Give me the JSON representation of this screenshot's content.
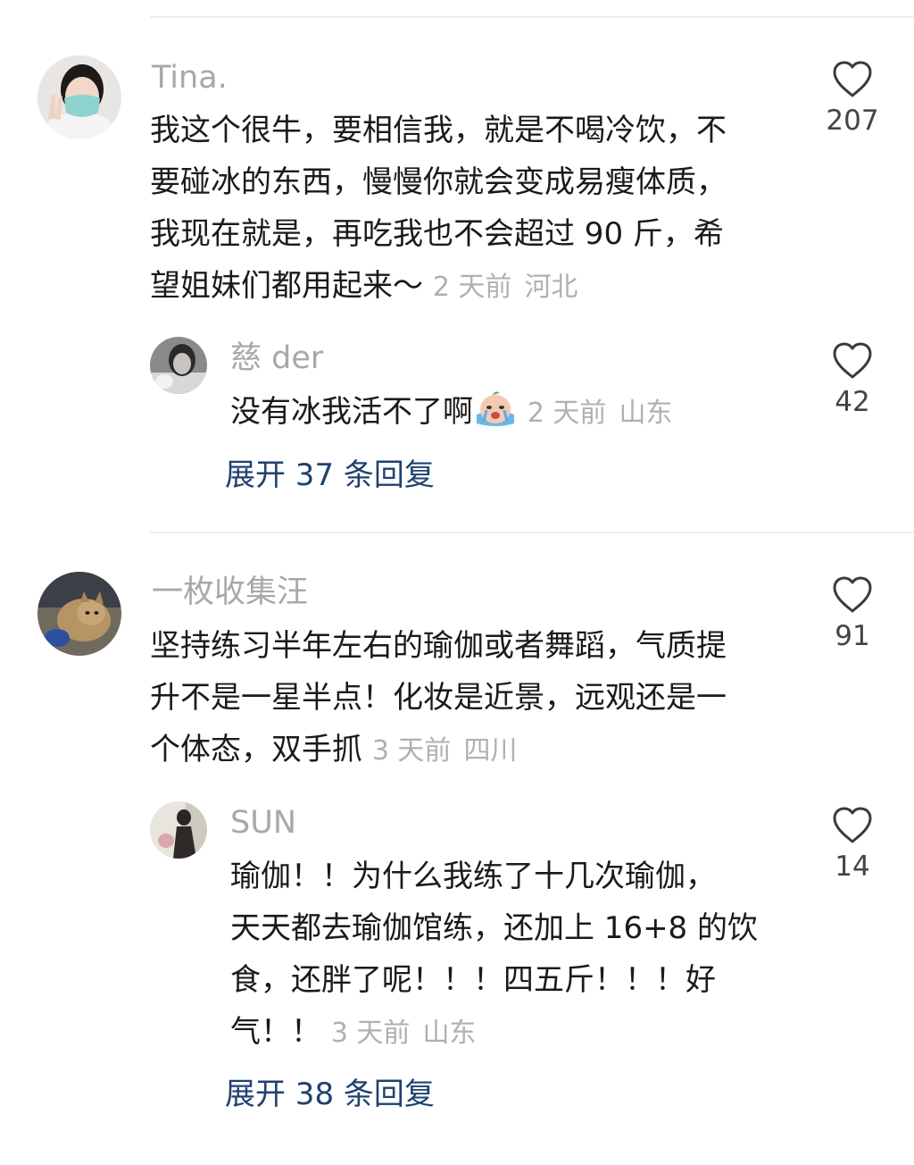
{
  "colors": {
    "link": "#1f4170",
    "meta": "#b0b0b0",
    "username": "#a8a8a8",
    "divider": "#eeeeee"
  },
  "comments": [
    {
      "username": "Tina.",
      "lines": [
        "我这个很牛，要相信我，就是不喝冷饮，不",
        "要碰冰的东西，慢慢你就会变成易瘦体质，",
        "我现在就是，再吃我也不会超过 90 斤，希",
        "望姐妹们都用起来～"
      ],
      "time": "2 天前",
      "location": "河北",
      "likes": "207",
      "reply": {
        "username": "慈 der",
        "lines": [
          "没有冰我活不了啊"
        ],
        "emoji": "crying-emoji",
        "time": "2 天前",
        "location": "山东",
        "likes": "42"
      },
      "expand_label": "展开 37 条回复"
    },
    {
      "username": "一枚收集汪",
      "lines": [
        "坚持练习半年左右的瑜伽或者舞蹈，气质提",
        "升不是一星半点！化妆是近景，远观还是一",
        "个体态，双手抓"
      ],
      "time": "3 天前",
      "location": "四川",
      "likes": "91",
      "reply": {
        "username": "SUN",
        "lines": [
          "瑜伽！！为什么我练了十几次瑜伽，",
          "天天都去瑜伽馆练，还加上 16+8 的饮",
          "食，还胖了呢！！！四五斤！！！好",
          "气！！"
        ],
        "time": "3 天前",
        "location": "山东",
        "likes": "14"
      },
      "expand_label": "展开 38 条回复"
    }
  ]
}
